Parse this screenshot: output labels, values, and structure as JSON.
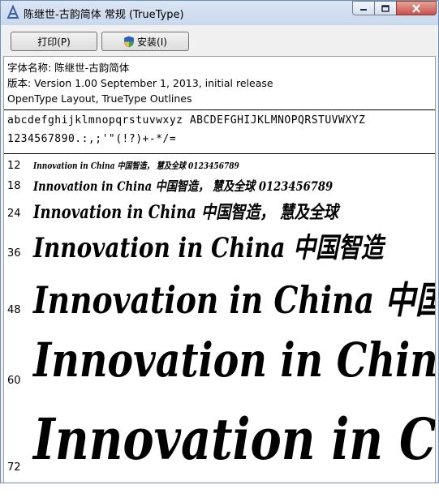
{
  "window": {
    "title": "陈继世-古韵简体 常规 (TrueType)",
    "icons": [
      "font-app-icon",
      "minimize-icon",
      "maximize-icon",
      "close-icon"
    ]
  },
  "toolbar": {
    "print_label": "打印(P)",
    "install_label": "安装(I)",
    "install_icon": "uac-shield-icon"
  },
  "info": {
    "font_name": "字体名称: 陈继世-古韵简体",
    "version": "版本: Version 1.00 September 1, 2013, initial release",
    "outlines": "OpenType Layout, TrueType Outlines"
  },
  "glyphs": {
    "line1": "abcdefghijklmnopqrstuvwxyz ABCDEFGHIJKLMNOPQRSTUVWXYZ",
    "line2": "1234567890.:,;'\"(!?)+-*/="
  },
  "samples": [
    {
      "size": "12",
      "text": "Innovation in China 中国智造， 慧及全球 0123456789"
    },
    {
      "size": "18",
      "text": "Innovation in China 中国智造， 慧及全球 0123456789"
    },
    {
      "size": "24",
      "text": "Innovation in China 中国智造， 慧及全球"
    },
    {
      "size": "36",
      "text": "Innovation in China 中国智造"
    },
    {
      "size": "48",
      "text": "Innovation in China 中国"
    },
    {
      "size": "60",
      "text": "Innovation in China"
    },
    {
      "size": "72",
      "text": "Innovation in China"
    }
  ]
}
